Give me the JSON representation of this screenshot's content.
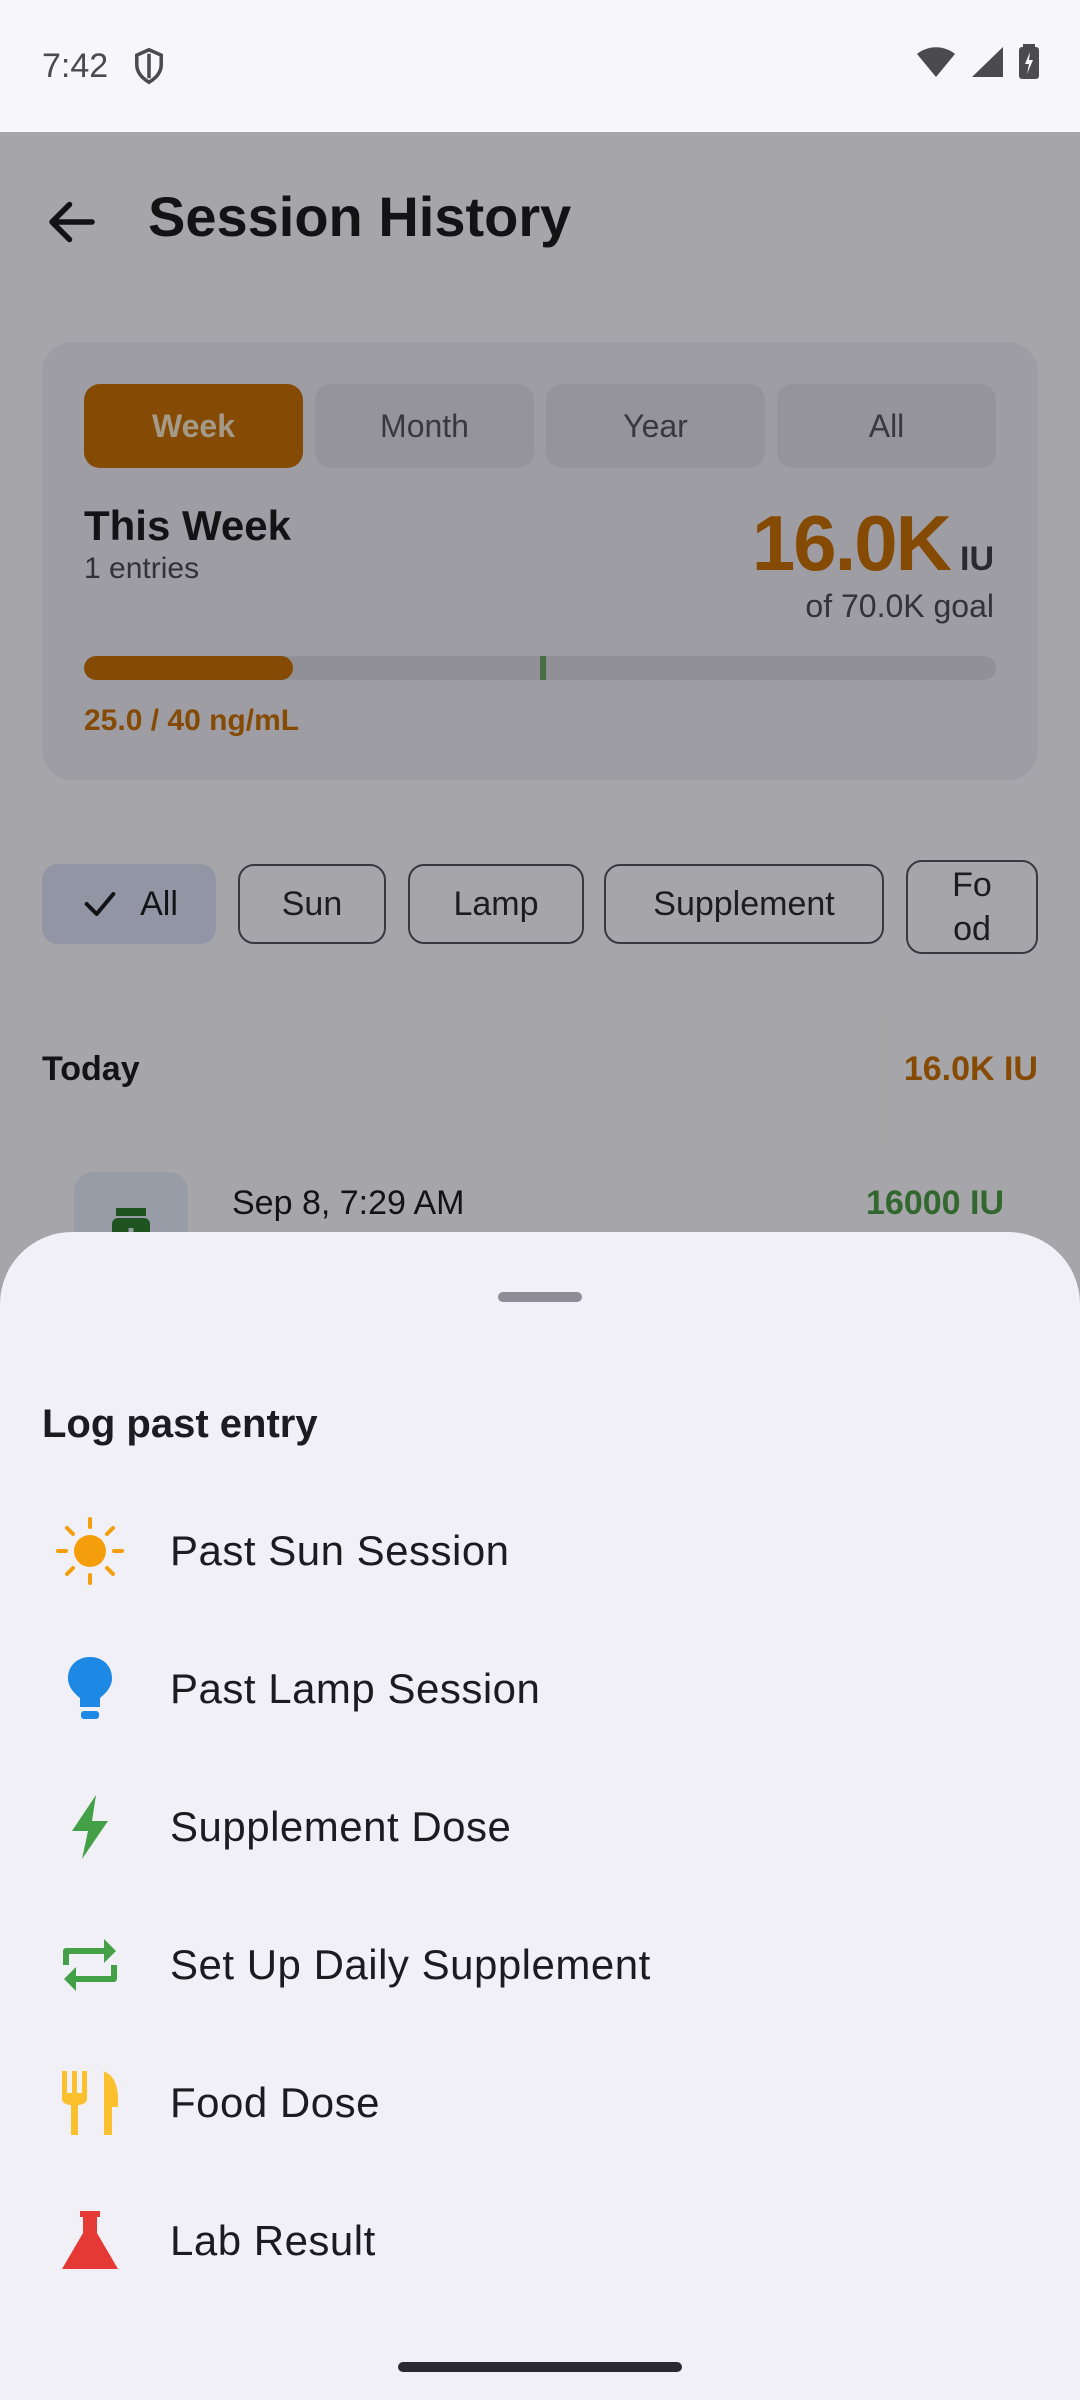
{
  "status_bar": {
    "time": "7:42"
  },
  "app_bar": {
    "title": "Session History"
  },
  "summary": {
    "period_tabs": [
      {
        "label": "Week",
        "active": true
      },
      {
        "label": "Month",
        "active": false
      },
      {
        "label": "Year",
        "active": false
      },
      {
        "label": "All",
        "active": false
      }
    ],
    "period_title": "This Week",
    "entries_text": "1 entries",
    "total_value": "16.0K",
    "total_unit": "IU",
    "goal_text": "of 70.0K goal",
    "progress_fraction": 0.229,
    "target_marker_fraction": 0.5,
    "level_text": "25.0 / 40 ng/mL",
    "accent_color": "#c46e06",
    "marker_color": "#69a262"
  },
  "filters": {
    "chips": [
      {
        "label": "All",
        "selected": true
      },
      {
        "label": "Sun",
        "selected": false
      },
      {
        "label": "Lamp",
        "selected": false
      },
      {
        "label": "Supplement",
        "selected": false
      },
      {
        "label": "Fo\nod",
        "selected": false
      }
    ]
  },
  "history": {
    "section": "Today",
    "section_total": "16.0K IU",
    "entries": [
      {
        "date": "Sep 8, 7:29 AM",
        "amount": "16000 IU",
        "icon": "pill-bottle-icon"
      }
    ]
  },
  "sheet": {
    "title": "Log past entry",
    "options": [
      {
        "label": "Past Sun Session",
        "icon": "sun-icon",
        "color": "#f59e0b"
      },
      {
        "label": "Past Lamp Session",
        "icon": "lightbulb-icon",
        "color": "#1e88e5"
      },
      {
        "label": "Supplement Dose",
        "icon": "bolt-icon",
        "color": "#43a047"
      },
      {
        "label": "Set Up Daily Supplement",
        "icon": "repeat-icon",
        "color": "#43a047"
      },
      {
        "label": "Food Dose",
        "icon": "utensils-icon",
        "color": "#fbc02d"
      },
      {
        "label": "Lab Result",
        "icon": "flask-icon",
        "color": "#e53935"
      }
    ]
  }
}
